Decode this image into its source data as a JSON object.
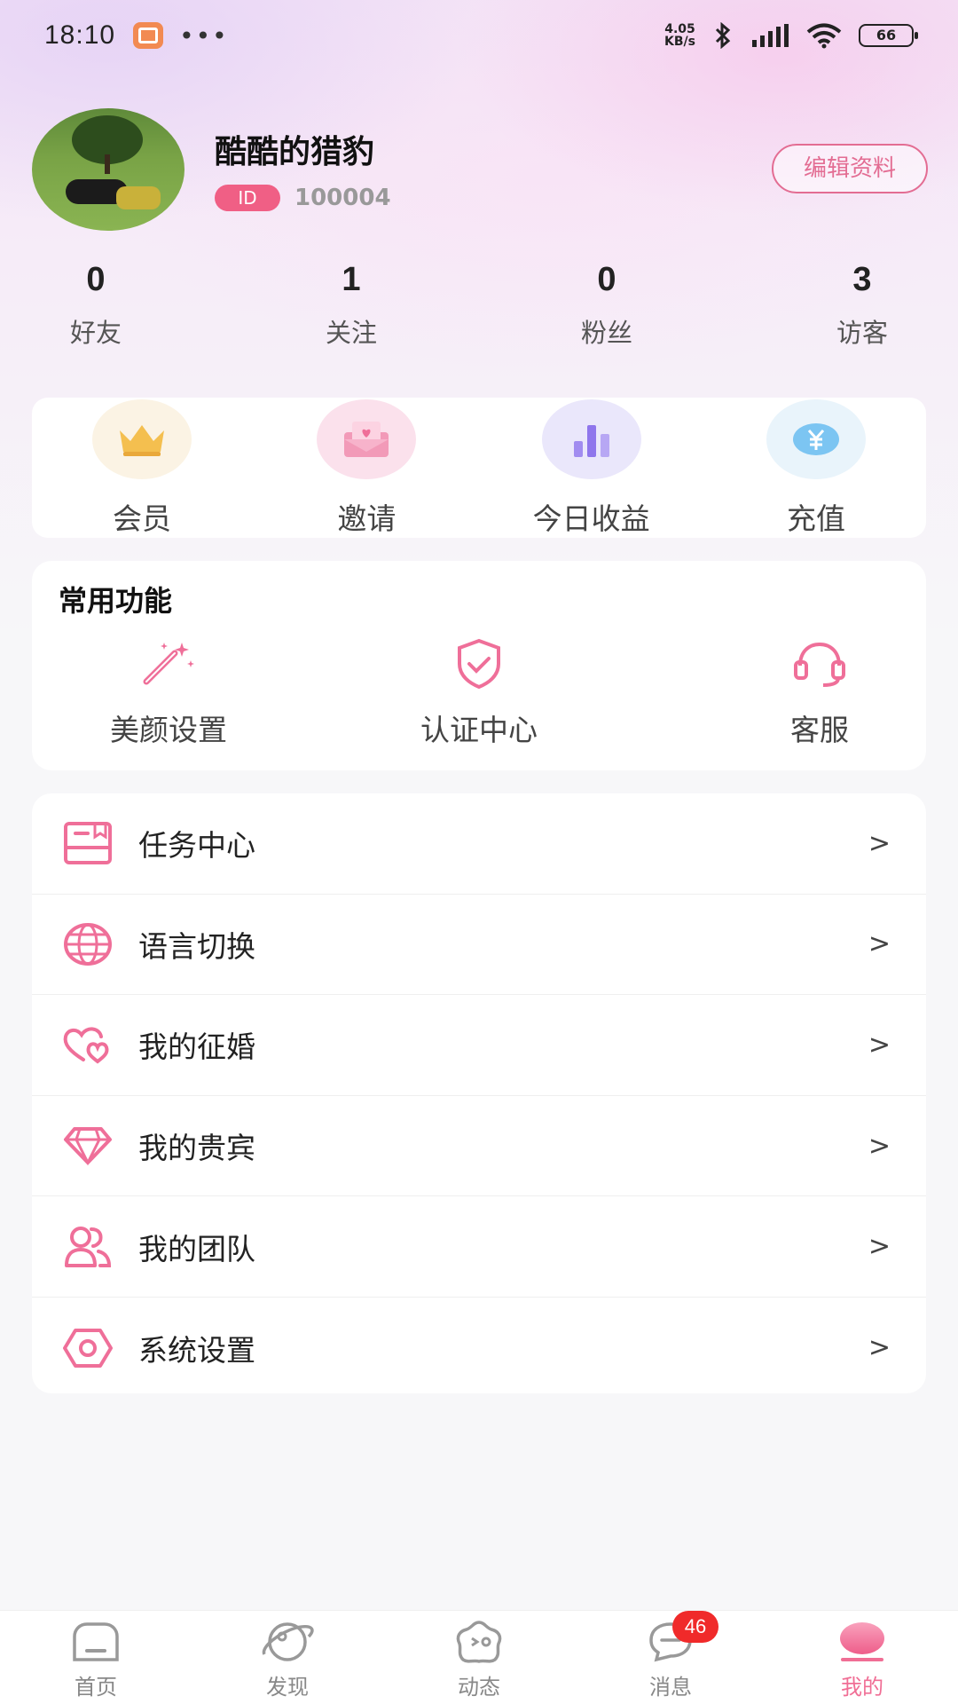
{
  "status": {
    "time": "18:10",
    "dots": "•••",
    "net_speed_value": "4.05",
    "net_speed_unit": "KB/s",
    "battery": "66"
  },
  "profile": {
    "nickname": "酷酷的猎豹",
    "id_badge": "ID",
    "id_number": "100004",
    "edit_button": "编辑资料"
  },
  "stats": [
    {
      "value": "0",
      "label": "好友"
    },
    {
      "value": "1",
      "label": "关注"
    },
    {
      "value": "0",
      "label": "粉丝"
    },
    {
      "value": "3",
      "label": "访客"
    }
  ],
  "quick_actions": [
    {
      "label": "会员",
      "icon": "crown-icon",
      "bg": "#fbf3e4"
    },
    {
      "label": "邀请",
      "icon": "envelope-heart-icon",
      "bg": "#fbe1ec"
    },
    {
      "label": "今日收益",
      "icon": "bar-chart-icon",
      "bg": "#eae7fb"
    },
    {
      "label": "充值",
      "icon": "yuan-coin-icon",
      "bg": "#e9f4fb"
    }
  ],
  "common_functions": {
    "title": "常用功能",
    "items": [
      {
        "label": "美颜设置",
        "icon": "magic-wand-icon"
      },
      {
        "label": "认证中心",
        "icon": "shield-check-icon"
      },
      {
        "label": "客服",
        "icon": "headset-icon"
      }
    ]
  },
  "menu": [
    {
      "label": "任务中心",
      "icon": "task-box-icon"
    },
    {
      "label": "语言切换",
      "icon": "globe-icon"
    },
    {
      "label": "我的征婚",
      "icon": "hearts-icon"
    },
    {
      "label": "我的贵宾",
      "icon": "diamond-icon"
    },
    {
      "label": "我的团队",
      "icon": "team-icon"
    },
    {
      "label": "系统设置",
      "icon": "settings-hexagon-icon"
    }
  ],
  "menu_arrow": ">",
  "tabs": [
    {
      "label": "首页",
      "icon": "home-icon"
    },
    {
      "label": "发现",
      "icon": "planet-icon"
    },
    {
      "label": "动态",
      "icon": "star-face-icon"
    },
    {
      "label": "消息",
      "icon": "chat-bubble-icon",
      "badge": "46"
    },
    {
      "label": "我的",
      "icon": "profile-dot-icon",
      "active": true
    }
  ],
  "colors": {
    "accent": "#f06e95",
    "badge_red": "#f02a2a"
  }
}
